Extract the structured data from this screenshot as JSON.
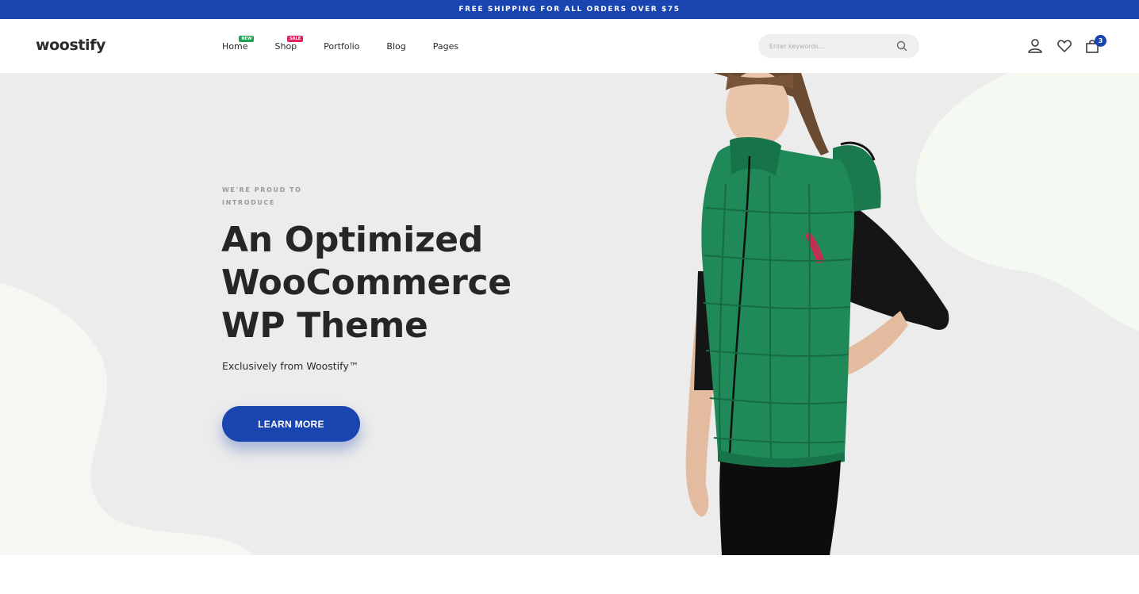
{
  "announcement": {
    "text": "FREE SHIPPING FOR ALL ORDERS OVER $75"
  },
  "header": {
    "logo": "woostify",
    "nav": [
      {
        "label": "Home",
        "badge": "NEW"
      },
      {
        "label": "Shop",
        "badge": "SALE"
      },
      {
        "label": "Portfolio"
      },
      {
        "label": "Blog"
      },
      {
        "label": "Pages"
      }
    ],
    "search": {
      "placeholder": "Enter keywords..."
    },
    "icons": [
      "user-icon",
      "heart-icon",
      "bag-icon"
    ],
    "cart_count": "3"
  },
  "hero": {
    "eyebrow": "WE'RE PROUD TO INTRODUCE",
    "title": "An Optimized WooCommerce WP Theme",
    "subtitle": "Exclusively from Woostify™",
    "cta_label": "LEARN MORE"
  },
  "colors": {
    "brand": "#1a45b0",
    "badge_new": "#1ea355",
    "badge_sale": "#e0245e",
    "hero_bg": "#ececec",
    "vest": "#1f8a58"
  }
}
